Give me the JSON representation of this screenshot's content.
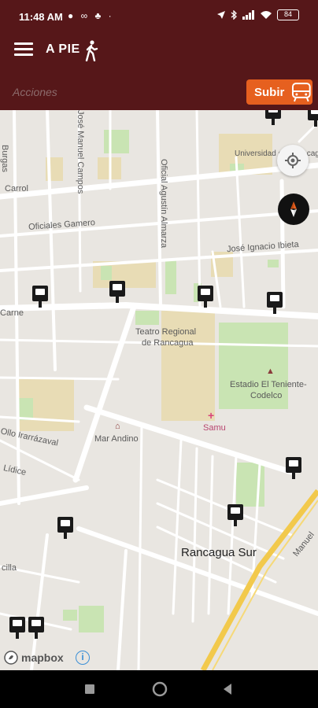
{
  "status_bar": {
    "time": "11:48 AM",
    "left_icons": "● ∞ ♣ ·",
    "battery": "84"
  },
  "app_bar": {
    "title": "A PIE",
    "actions_label": "Acciones",
    "subir_label": "Subir"
  },
  "map": {
    "streets": {
      "carrol": "Carrol",
      "oficiales_gamero": "Oficiales Gamero",
      "jose_ignacio_ibieta": "José Ignacio Ibieta",
      "oficial_agustin_almarza": "Oficial Agustín Almarza",
      "jose_manuel_campos": "José Manuel Campos",
      "carne": "Carne",
      "burgas": "Burgas",
      "irarrazaval": "Ollo Irarrázaval",
      "lidice": "Lídice",
      "cilla": "cilla",
      "manuel": "Manuel"
    },
    "places": {
      "universidad": "Universidad de Aconcagua",
      "teatro_line1": "Teatro Regional",
      "teatro_line2": "de Rancagua",
      "estadio_line1": "Estadio El Teniente-",
      "estadio_line2": "Codelco",
      "samu": "Samu",
      "mar_andino": "Mar Andino",
      "rancagua_sur": "Rancagua Sur"
    },
    "attribution": "mapbox"
  },
  "colors": {
    "primary": "#561719",
    "accent": "#e6601f",
    "map_bg": "#e9e6e1",
    "park": "#c9e4b3",
    "rail": "#f2c94c"
  }
}
